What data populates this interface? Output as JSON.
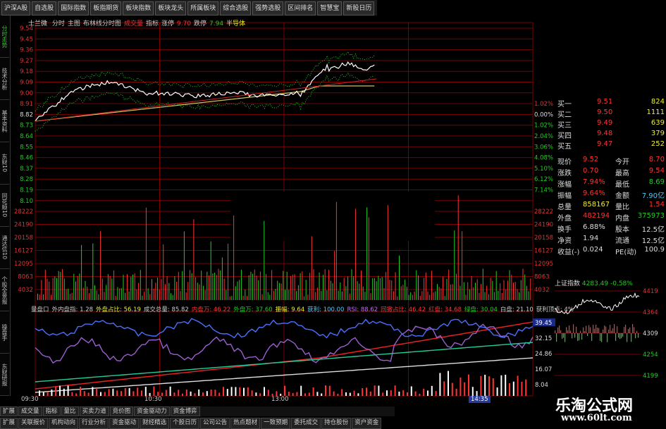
{
  "toolbar": {
    "buttons": [
      "沪深A股",
      "自选股",
      "国际指数",
      "板指期货",
      "板块指数",
      "板块龙头",
      "所属板块",
      "综合选股",
      "强势选股",
      "区间排名",
      "智慧宝",
      "新股日历"
    ]
  },
  "left_tabs": [
    "分时走势",
    "技术分析",
    "基本资料",
    "东财10",
    "同花顺10",
    "通达信10",
    "个股全景报",
    "操盘手",
    "东财研报"
  ],
  "main_panel": {
    "title": "士兰微",
    "header_items": [
      "分时",
      "主图",
      "布林线分时图",
      "成交量",
      "指标",
      "涨停",
      "9.70",
      "跌停",
      "7.94",
      "半导体"
    ],
    "price_axis": [
      "9.54",
      "9.45",
      "9.36",
      "9.27",
      "9.18",
      "9.09",
      "9.00",
      "8.91",
      "8.82",
      "8.73",
      "8.64",
      "8.55",
      "8.46",
      "8.37",
      "8.28",
      "8.19",
      "8.10"
    ],
    "pct_axis": [
      "1.02%",
      "0.00%",
      "1.02%",
      "2.04%",
      "3.06%",
      "4.08%",
      "5.10%",
      "6.12%",
      "7.14%"
    ],
    "volume_axis_left": [
      "28222",
      "24190",
      "20158",
      "16127",
      "12095",
      "8063",
      "4032"
    ],
    "volume_axis_right": [
      "28222",
      "24190",
      "20158",
      "16127",
      "12095",
      "8063",
      "4032"
    ]
  },
  "lower_panel": {
    "header": [
      "量盘口",
      "外内盘指: 1.28",
      "外盘占比: 56.19",
      "成交总量: 85.82",
      "内盘万: 46.22",
      "外盘万: 37.60",
      "振幅: 9.64",
      "获利: 100.00",
      "RSI: 88.62",
      "回撤占比: 46.42",
      "红盘: 34.68",
      "绿盘: 30.04",
      "白盘: 21.10",
      "获利顶点: 4%"
    ],
    "axis_right": [
      "39.45",
      "32.15",
      "24.86",
      "16.07",
      "8.04"
    ]
  },
  "time_axis": [
    "09:30",
    "10:30",
    "13:00",
    "14:35"
  ],
  "quotes": {
    "book": [
      {
        "label": "买一",
        "price": "9.51",
        "vol": "824"
      },
      {
        "label": "买二",
        "price": "9.50",
        "vol": "1111"
      },
      {
        "label": "买三",
        "price": "9.49",
        "vol": "639"
      },
      {
        "label": "买四",
        "price": "9.48",
        "vol": "379"
      },
      {
        "label": "买五",
        "price": "9.47",
        "vol": "252"
      }
    ],
    "stats": [
      {
        "l1": "现价",
        "v1": "9.52",
        "l2": "今开",
        "v2": "8.70"
      },
      {
        "l1": "涨跌",
        "v1": "0.70",
        "l2": "最高",
        "v2": "9.54"
      },
      {
        "l1": "涨幅",
        "v1": "7.94%",
        "l2": "最低",
        "v2": "8.69"
      },
      {
        "l1": "振幅",
        "v1": "9.64%",
        "l2": "金额",
        "v2": "7.90亿"
      },
      {
        "l1": "总量",
        "v1": "858167",
        "l2": "量比",
        "v2": "1.54"
      },
      {
        "l1": "外盘",
        "v1": "482194",
        "l2": "内盘",
        "v2": "375973"
      },
      {
        "l1": "换手",
        "v1": "6.88%",
        "l2": "股本",
        "v2": "12.5亿"
      },
      {
        "l1": "净资",
        "v1": "1.94",
        "l2": "流通",
        "v2": "12.5亿"
      },
      {
        "l1": "收益(-)",
        "v1": "0.024",
        "l2": "PE(动)",
        "v2": "100.9"
      }
    ]
  },
  "index_panel": {
    "name": "上证指数",
    "value": "4283.49",
    "change": "-0.58%",
    "axis": [
      "4419",
      "4364",
      "4309",
      "4254",
      "4199"
    ]
  },
  "bottom_tabs_1": [
    "扩展",
    "成交量",
    "指标",
    "量比",
    "买卖力道",
    "竞价图",
    "资金驱动力",
    "资金博弈"
  ],
  "bottom_tabs_2": [
    "扩展",
    "关联报价",
    "机构动向",
    "行业分析",
    "资金驱动",
    "财经精选",
    "个股日历",
    "公司公告",
    "热点题材",
    "一致预期",
    "委托成交",
    "持仓股份",
    "资户资金"
  ],
  "brand": {
    "name": "乐淘公式网",
    "url": "www.60lt.com"
  },
  "colors": {
    "up": "#ff3333",
    "down": "#22cc22",
    "grid": "#8b0000",
    "price_line": "#ffffff",
    "avg_line": "#d4c45a"
  }
}
